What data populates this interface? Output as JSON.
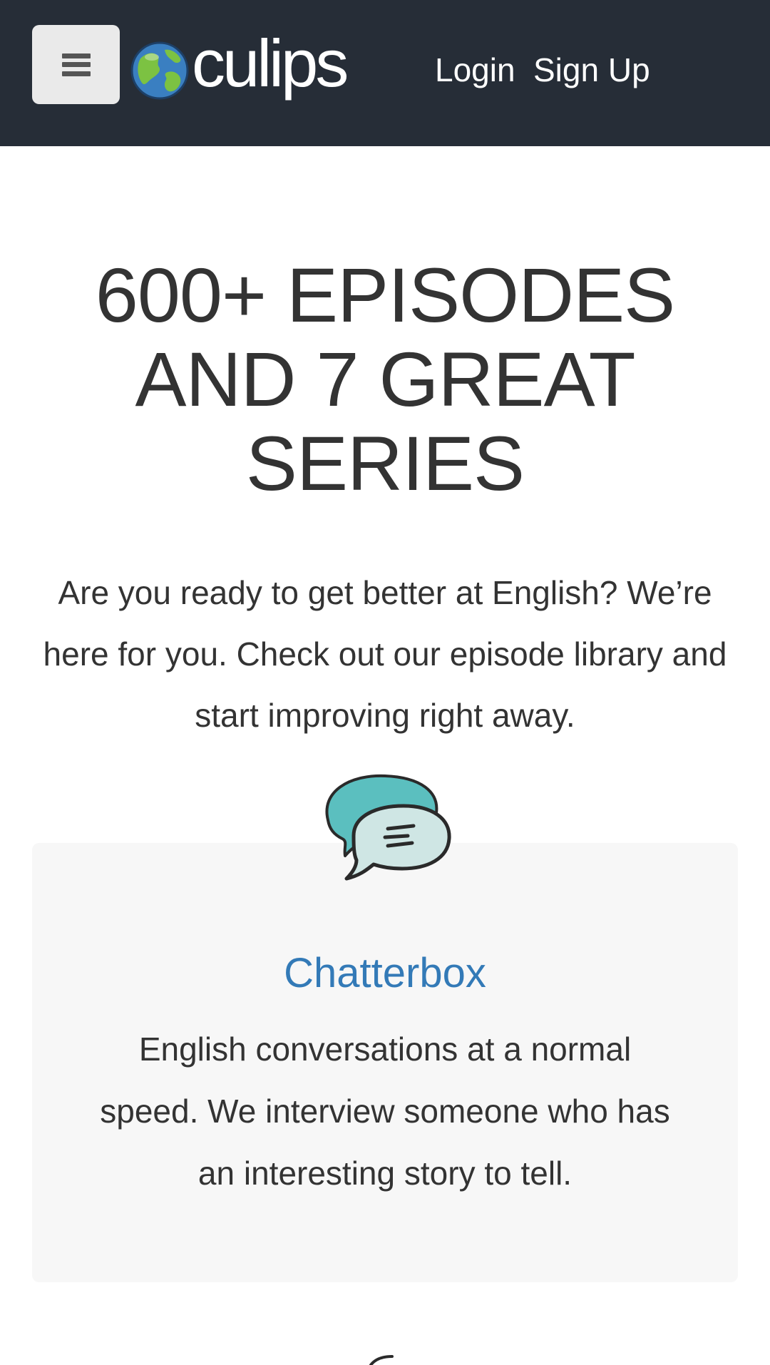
{
  "header": {
    "logo_text": "culips",
    "login_label": "Login",
    "signup_label": "Sign Up"
  },
  "hero": {
    "title": "600+ EPISODES AND 7 GREAT SERIES",
    "intro": "Are you ready to get better at English? We’re here for you. Check out our episode library and start improving right away."
  },
  "series": [
    {
      "icon": "speech-bubbles-icon",
      "title": "Chatterbox",
      "description": "English conversations at a normal speed. We interview someone who has an interesting story to tell."
    }
  ],
  "colors": {
    "navbar_bg": "#262d37",
    "link_blue": "#337ab7",
    "card_bg": "#f7f7f7",
    "bubble_teal": "#5bbfbf",
    "bubble_light": "#cfe6e4"
  }
}
